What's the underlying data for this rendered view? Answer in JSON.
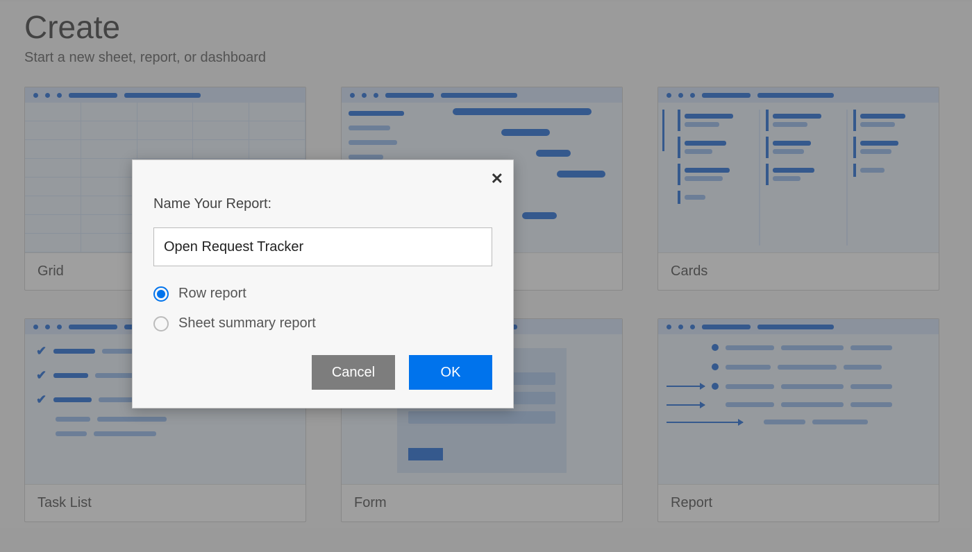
{
  "page": {
    "title": "Create",
    "subtitle": "Start a new sheet, report, or dashboard"
  },
  "templates": [
    {
      "label": "Grid"
    },
    {
      "label": "Cards"
    },
    {
      "label": "Task List"
    },
    {
      "label": "Form"
    },
    {
      "label": "Report"
    }
  ],
  "dialog": {
    "title": "Name Your Report:",
    "input_value": "Open Request Tracker",
    "options": [
      {
        "label": "Row report",
        "checked": true
      },
      {
        "label": "Sheet summary report",
        "checked": false
      }
    ],
    "cancel": "Cancel",
    "ok": "OK"
  }
}
